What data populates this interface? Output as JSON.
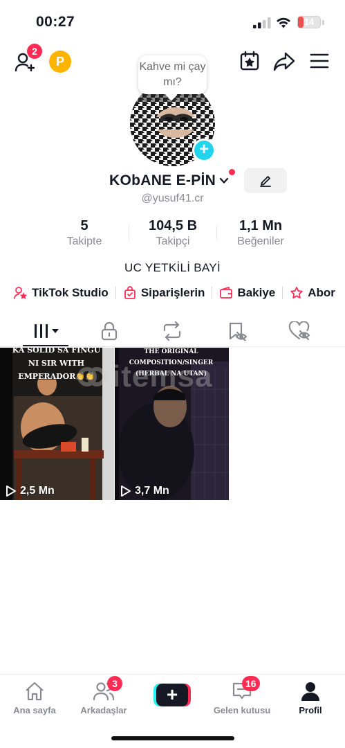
{
  "status_bar": {
    "time": "00:27",
    "battery_level": "14",
    "battery_fraction": 0.14,
    "battery_color": "#f04e4e"
  },
  "top_nav": {
    "add_friend_badge": "2",
    "coin_letter": "P",
    "icons": [
      "add-friend-icon",
      "coin-icon",
      "calendar-star-icon",
      "share-icon",
      "menu-icon"
    ]
  },
  "profile": {
    "bubble_text": "Kahve mi çay mı?",
    "display_name": "KObANE E-PİN",
    "username": "@yusuf41.cr",
    "bio": "UC YETKİLİ BAYİ"
  },
  "stats": [
    {
      "value": "5",
      "label": "Takipte"
    },
    {
      "value": "104,5 B",
      "label": "Takipçi"
    },
    {
      "value": "1,1 Mn",
      "label": "Beğeniler"
    }
  ],
  "shortcuts": [
    {
      "label": "TikTok Studio",
      "icon": "studio-icon"
    },
    {
      "label": "Siparişlerin",
      "icon": "orders-bag-icon"
    },
    {
      "label": "Bakiye",
      "icon": "wallet-icon"
    },
    {
      "label": "Abor",
      "icon": "subscription-icon"
    }
  ],
  "tabs": [
    "videos-grid-icon",
    "lock-icon",
    "repost-icon",
    "favorites-icon",
    "liked-icon"
  ],
  "videos": [
    {
      "views": "2,5 Mn",
      "caption": "KA SOLID SA FINGU NI SIR WITH EMPERADOR👏👏"
    },
    {
      "views": "3,7 Mn",
      "caption": "THE ORIGINAL COMPOSITION/SINGER (HERBAL NA UTAN)"
    }
  ],
  "watermark": "itemsa",
  "bottom_nav": {
    "home": "Ana sayfa",
    "friends": "Arkadaşlar",
    "friends_badge": "3",
    "inbox": "Gelen kutusu",
    "inbox_badge": "16",
    "profile": "Profil"
  },
  "colors": {
    "accent": "#fe2c55",
    "cyan": "#25f4ee",
    "avatar_add": "#20d5ec",
    "coin": "#ffb400"
  }
}
